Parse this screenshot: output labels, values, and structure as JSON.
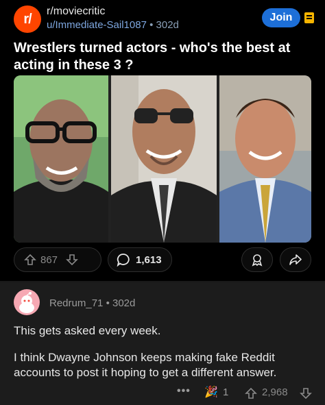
{
  "post": {
    "subreddit": "r/moviecritic",
    "subreddit_icon_text": "r/",
    "author": "u/Immediate-Sail1087",
    "separator": "•",
    "age": "302d",
    "join_label": "Join",
    "title": "Wrestlers turned actors - who's the best at acting in these 3 ?",
    "upvotes": "867",
    "comments": "1,613",
    "icons": [
      "arrow-up-icon",
      "arrow-down-icon",
      "comment-icon",
      "award-icon",
      "share-icon"
    ]
  },
  "comment": {
    "author": "Redrum_71",
    "separator": "•",
    "age": "302d",
    "line1": "This gets asked every week.",
    "line2": "I think Dwayne Johnson keeps making fake Reddit accounts to post it hoping to get a different answer.",
    "more": "•••",
    "award_emoji": "🎉",
    "award_count": "1",
    "score": "2,968"
  },
  "colors": {
    "accent": "#ff4500",
    "join": "#1d6fd8",
    "award": "#f5b400",
    "comment_bg": "#1c1c1c"
  }
}
